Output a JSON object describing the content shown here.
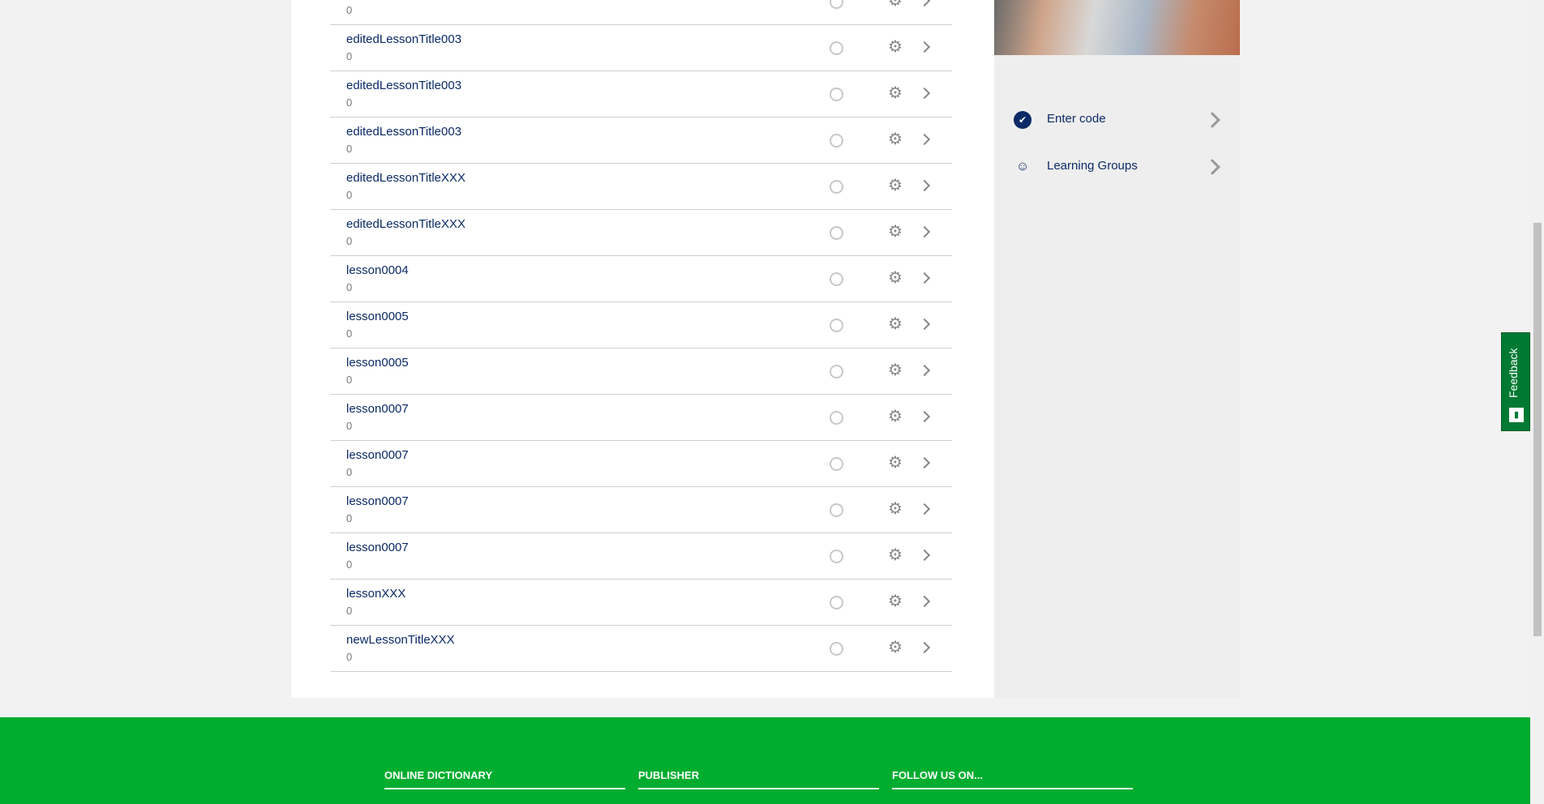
{
  "lessons": [
    {
      "title": "",
      "count": "0"
    },
    {
      "title": "editedLessonTitle003",
      "count": "0"
    },
    {
      "title": "editedLessonTitle003",
      "count": "0"
    },
    {
      "title": "editedLessonTitle003",
      "count": "0"
    },
    {
      "title": "editedLessonTitleXXX",
      "count": "0"
    },
    {
      "title": "editedLessonTitleXXX",
      "count": "0"
    },
    {
      "title": "lesson0004",
      "count": "0"
    },
    {
      "title": "lesson0005",
      "count": "0"
    },
    {
      "title": "lesson0005",
      "count": "0"
    },
    {
      "title": "lesson0007",
      "count": "0"
    },
    {
      "title": "lesson0007",
      "count": "0"
    },
    {
      "title": "lesson0007",
      "count": "0"
    },
    {
      "title": "lesson0007",
      "count": "0"
    },
    {
      "title": "lessonXXX",
      "count": "0"
    },
    {
      "title": "newLessonTitleXXX",
      "count": "0"
    }
  ],
  "sidebar": {
    "items": [
      {
        "label": "Enter code",
        "icon": "check-badge-icon"
      },
      {
        "label": "Learning Groups",
        "icon": "groups-icon"
      }
    ]
  },
  "footer": {
    "columns": [
      "ONLINE DICTIONARY",
      "PUBLISHER",
      "FOLLOW US ON..."
    ]
  },
  "feedback": {
    "label": "Feedback"
  },
  "colors": {
    "brand": "#00ad2f",
    "text": "#0a2a66",
    "feedback": "#007a33"
  }
}
